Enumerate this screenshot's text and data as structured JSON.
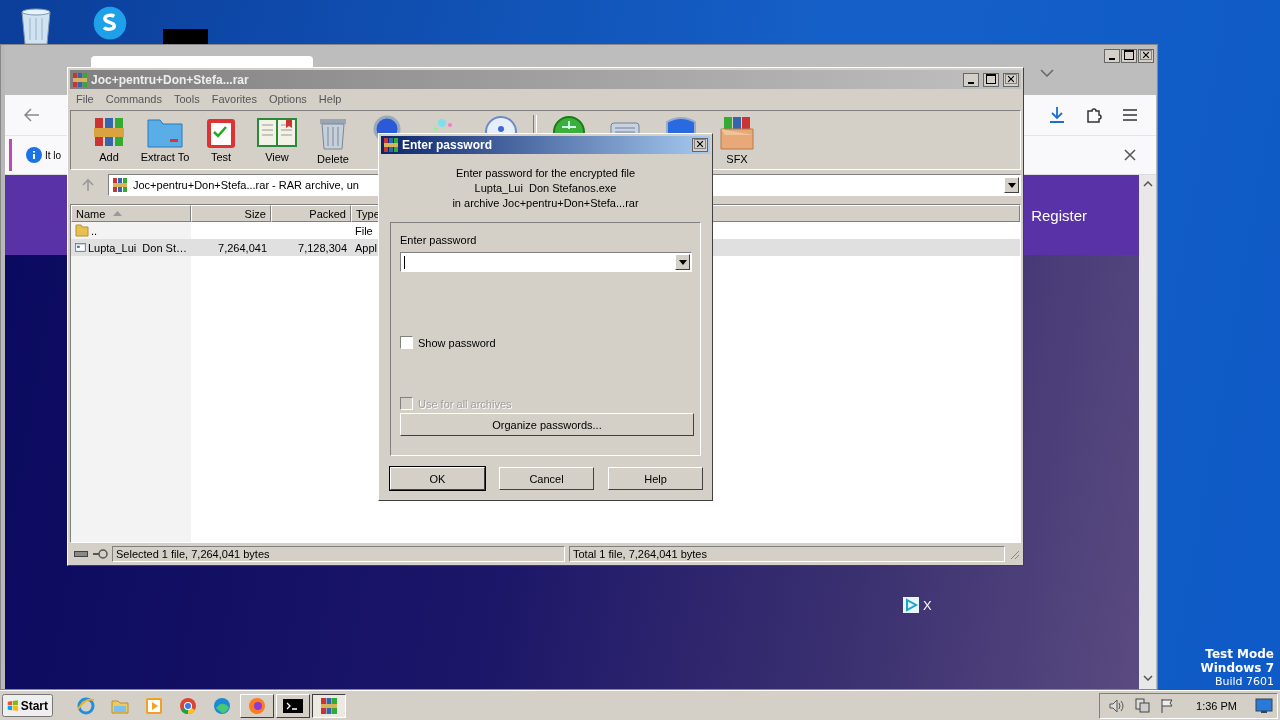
{
  "browser": {
    "infobar_text": "It lo",
    "header_link": "Register"
  },
  "winrar": {
    "title": "Joc+pentru+Don+Stefa...rar",
    "menu": [
      "File",
      "Commands",
      "Tools",
      "Favorites",
      "Options",
      "Help"
    ],
    "toolbar": [
      {
        "kind": "add",
        "label": "Add"
      },
      {
        "kind": "extract",
        "label": "Extract To"
      },
      {
        "kind": "test",
        "label": "Test"
      },
      {
        "kind": "view",
        "label": "View"
      },
      {
        "kind": "delete",
        "label": "Delete"
      },
      {
        "kind": "find"
      },
      {
        "kind": "wizard"
      },
      {
        "kind": "info"
      },
      {
        "kind": "scan"
      },
      {
        "kind": "comment"
      },
      {
        "kind": "protect"
      },
      {
        "kind": "sfx",
        "label": "SFX"
      }
    ],
    "address": "Joc+pentru+Don+Stefa...rar - RAR archive, un",
    "columns": [
      "Name",
      "Size",
      "Packed",
      "Type"
    ],
    "rows": [
      {
        "kind": "folder",
        "name": "..",
        "type": "File",
        "selected": false
      },
      {
        "kind": "file",
        "name": "Lupta_Lui  Don St…",
        "size": "7,264,041",
        "packed": "7,128,304",
        "type": "Appl",
        "selected": true
      }
    ],
    "status": [
      "Selected 1 file, 7,264,041 bytes",
      "Total 1 file, 7,264,041 bytes"
    ]
  },
  "dialog": {
    "title": "Enter password",
    "message": [
      "Enter password for the encrypted file",
      "Lupta_Lui  Don Stefanos.exe",
      "in archive Joc+pentru+Don+Stefa...rar"
    ],
    "field_label": "Enter password",
    "options": [
      {
        "label": "Show password",
        "checked": false,
        "disabled": false
      },
      {
        "label": "Use for all archives",
        "checked": false,
        "disabled": true
      }
    ],
    "organize_button": "Organize passwords...",
    "buttons": [
      {
        "label": "OK",
        "default": true
      },
      {
        "label": "Cancel",
        "default": false
      },
      {
        "label": "Help",
        "default": false
      }
    ]
  },
  "ad": {
    "close": "X"
  },
  "os_info": [
    {
      "text": "Test Mode",
      "bold": true
    },
    {
      "text": "Windows 7",
      "bold": true
    },
    {
      "text": "Build 7601",
      "bold": false
    }
  ],
  "taskbar": {
    "start": "Start",
    "apps": [
      {
        "kind": "ie",
        "selected": false
      },
      {
        "kind": "folder",
        "selected": false
      },
      {
        "kind": "media",
        "selected": false
      },
      {
        "kind": "chrome",
        "selected": false
      },
      {
        "kind": "edge",
        "selected": false
      },
      {
        "kind": "firefox",
        "selected": false
      },
      {
        "kind": "cmd",
        "selected": false
      },
      {
        "kind": "winrar",
        "selected": true
      }
    ],
    "clock": "1:36 PM"
  }
}
